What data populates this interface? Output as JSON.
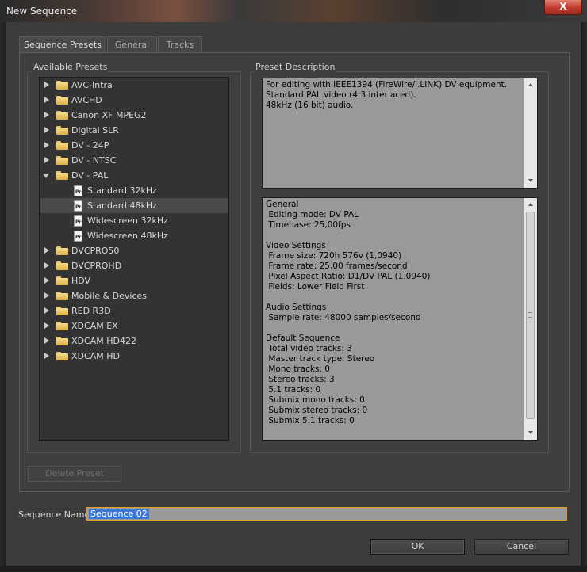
{
  "window": {
    "title": "New Sequence",
    "close_label": "X"
  },
  "tabs": [
    {
      "label": "Sequence Presets",
      "active": true
    },
    {
      "label": "General",
      "active": false
    },
    {
      "label": "Tracks",
      "active": false
    }
  ],
  "presets": {
    "label": "Available Presets",
    "items": [
      {
        "label": "AVC-Intra",
        "type": "folder",
        "expanded": false
      },
      {
        "label": "AVCHD",
        "type": "folder",
        "expanded": false
      },
      {
        "label": "Canon XF MPEG2",
        "type": "folder",
        "expanded": false
      },
      {
        "label": "Digital SLR",
        "type": "folder",
        "expanded": false
      },
      {
        "label": "DV - 24P",
        "type": "folder",
        "expanded": false
      },
      {
        "label": "DV - NTSC",
        "type": "folder",
        "expanded": false
      },
      {
        "label": "DV - PAL",
        "type": "folder",
        "expanded": true
      },
      {
        "label": "Standard 32kHz",
        "type": "preset",
        "selected": false
      },
      {
        "label": "Standard 48kHz",
        "type": "preset",
        "selected": true
      },
      {
        "label": "Widescreen 32kHz",
        "type": "preset",
        "selected": false
      },
      {
        "label": "Widescreen 48kHz",
        "type": "preset",
        "selected": false
      },
      {
        "label": "DVCPRO50",
        "type": "folder",
        "expanded": false
      },
      {
        "label": "DVCPROHD",
        "type": "folder",
        "expanded": false
      },
      {
        "label": "HDV",
        "type": "folder",
        "expanded": false
      },
      {
        "label": "Mobile & Devices",
        "type": "folder",
        "expanded": false
      },
      {
        "label": "RED R3D",
        "type": "folder",
        "expanded": false
      },
      {
        "label": "XDCAM EX",
        "type": "folder",
        "expanded": false
      },
      {
        "label": "XDCAM HD422",
        "type": "folder",
        "expanded": false
      },
      {
        "label": "XDCAM HD",
        "type": "folder",
        "expanded": false
      }
    ],
    "icons": {
      "folder": "folder-icon",
      "preset": "preset-file-icon",
      "collapsed": "expand-arrow-icon",
      "expanded": "collapse-arrow-icon"
    },
    "delete_label": "Delete Preset"
  },
  "description": {
    "label": "Preset Description",
    "summary": "For editing with IEEE1394 (FireWire/i.LINK) DV equipment.\nStandard PAL video (4:3 interlaced).\n48kHz (16 bit) audio.",
    "details": "General\n Editing mode: DV PAL\n Timebase: 25,00fps\n\nVideo Settings\n Frame size: 720h 576v (1,0940)\n Frame rate: 25,00 frames/second\n Pixel Aspect Ratio: D1/DV PAL (1.0940)\n Fields: Lower Field First\n\nAudio Settings\n Sample rate: 48000 samples/second\n\nDefault Sequence\n Total video tracks: 3\n Master track type: Stereo\n Mono tracks: 0\n Stereo tracks: 3\n 5.1 tracks: 0\n Submix mono tracks: 0\n Submix stereo tracks: 0\n Submix 5.1 tracks: 0"
  },
  "sequence_name": {
    "label": "Sequence Name:",
    "value": "Sequence 02"
  },
  "buttons": {
    "ok": "OK",
    "cancel": "Cancel"
  },
  "colors": {
    "selection": "#3a78d8",
    "focus_border": "#e8a020",
    "close": "#c0392b"
  }
}
